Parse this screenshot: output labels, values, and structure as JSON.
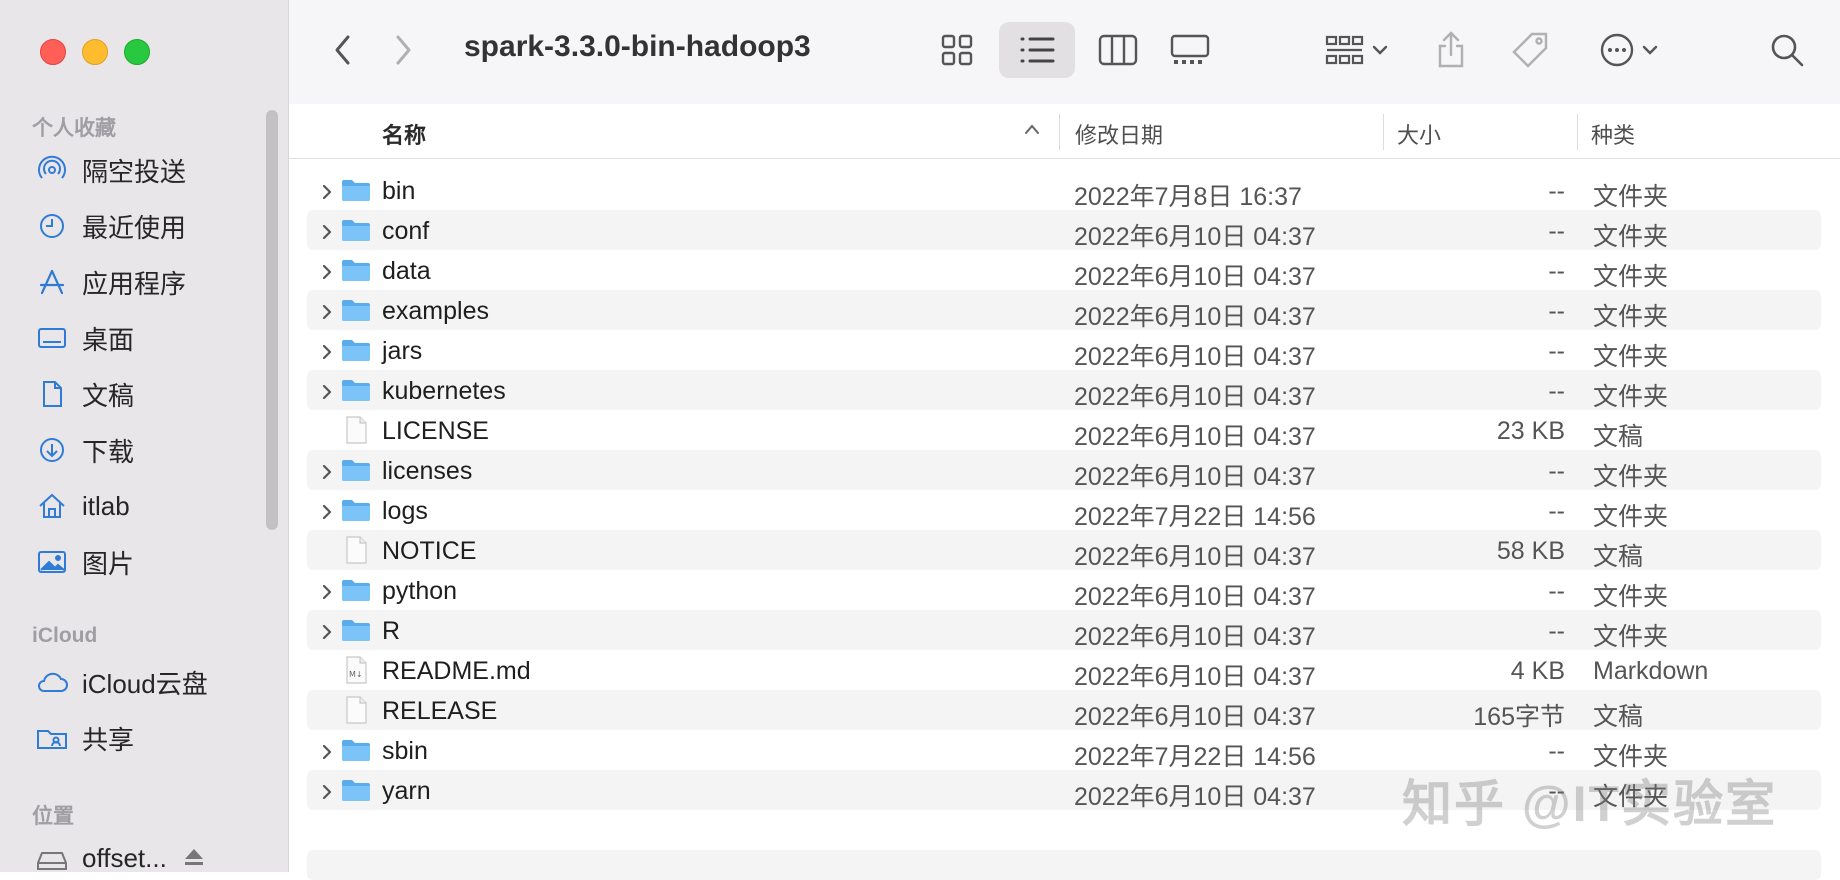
{
  "window": {
    "title": "spark-3.3.0-bin-hadoop3",
    "traffic_colors": [
      "#ff5f57",
      "#febc2e",
      "#28c840"
    ]
  },
  "sidebar": {
    "favorites_title": "个人收藏",
    "favorites": [
      {
        "label": "隔空投送",
        "icon": "airdrop-icon"
      },
      {
        "label": "最近使用",
        "icon": "clock-icon"
      },
      {
        "label": "应用程序",
        "icon": "applications-icon"
      },
      {
        "label": "桌面",
        "icon": "desktop-icon"
      },
      {
        "label": "文稿",
        "icon": "document-icon"
      },
      {
        "label": "下载",
        "icon": "download-icon"
      },
      {
        "label": "itlab",
        "icon": "home-icon"
      },
      {
        "label": "图片",
        "icon": "photo-icon"
      }
    ],
    "icloud_title": "iCloud",
    "icloud": [
      {
        "label": "iCloud云盘",
        "icon": "cloud-icon"
      },
      {
        "label": "共享",
        "icon": "shared-folder-icon"
      }
    ],
    "locations_title": "位置",
    "locations": [
      {
        "label": "offset...",
        "icon": "disk-icon"
      }
    ],
    "accent": "#2f7bd6"
  },
  "columns": {
    "name": "名称",
    "modified": "修改日期",
    "size": "大小",
    "kind": "种类"
  },
  "files": [
    {
      "name": "bin",
      "date": "2022年7月8日 16:37",
      "size": "--",
      "kind": "文件夹",
      "type": "folder"
    },
    {
      "name": "conf",
      "date": "2022年6月10日 04:37",
      "size": "--",
      "kind": "文件夹",
      "type": "folder"
    },
    {
      "name": "data",
      "date": "2022年6月10日 04:37",
      "size": "--",
      "kind": "文件夹",
      "type": "folder"
    },
    {
      "name": "examples",
      "date": "2022年6月10日 04:37",
      "size": "--",
      "kind": "文件夹",
      "type": "folder"
    },
    {
      "name": "jars",
      "date": "2022年6月10日 04:37",
      "size": "--",
      "kind": "文件夹",
      "type": "folder"
    },
    {
      "name": "kubernetes",
      "date": "2022年6月10日 04:37",
      "size": "--",
      "kind": "文件夹",
      "type": "folder"
    },
    {
      "name": "LICENSE",
      "date": "2022年6月10日 04:37",
      "size": "23 KB",
      "kind": "文稿",
      "type": "file"
    },
    {
      "name": "licenses",
      "date": "2022年6月10日 04:37",
      "size": "--",
      "kind": "文件夹",
      "type": "folder"
    },
    {
      "name": "logs",
      "date": "2022年7月22日 14:56",
      "size": "--",
      "kind": "文件夹",
      "type": "folder"
    },
    {
      "name": "NOTICE",
      "date": "2022年6月10日 04:37",
      "size": "58 KB",
      "kind": "文稿",
      "type": "file"
    },
    {
      "name": "python",
      "date": "2022年6月10日 04:37",
      "size": "--",
      "kind": "文件夹",
      "type": "folder"
    },
    {
      "name": "R",
      "date": "2022年6月10日 04:37",
      "size": "--",
      "kind": "文件夹",
      "type": "folder"
    },
    {
      "name": "README.md",
      "date": "2022年6月10日 04:37",
      "size": "4 KB",
      "kind": "Markdown",
      "type": "markdown"
    },
    {
      "name": "RELEASE",
      "date": "2022年6月10日 04:37",
      "size": "165字节",
      "kind": "文稿",
      "type": "file"
    },
    {
      "name": "sbin",
      "date": "2022年7月22日 14:56",
      "size": "--",
      "kind": "文件夹",
      "type": "folder"
    },
    {
      "name": "yarn",
      "date": "2022年6月10日 04:37",
      "size": "--",
      "kind": "文件夹",
      "type": "folder"
    }
  ],
  "watermark": "知乎 @IT实验室"
}
